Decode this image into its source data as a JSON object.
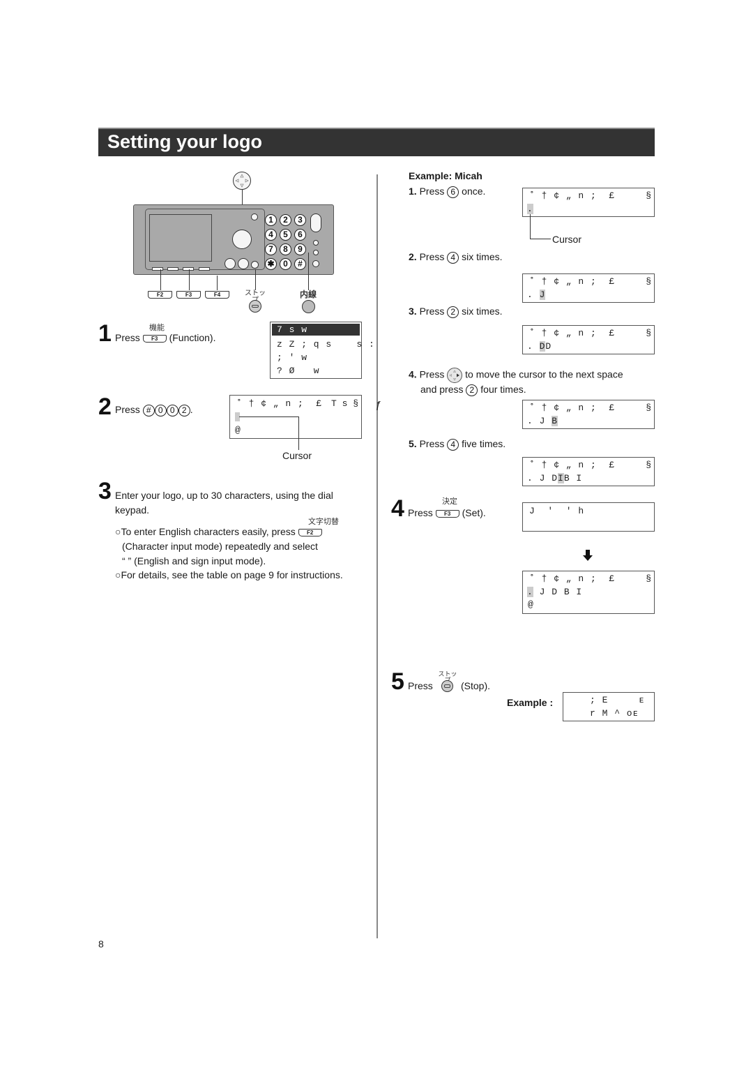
{
  "page": {
    "title": "Setting your logo",
    "page_number": "8"
  },
  "device": {
    "keypad": [
      "1",
      "2",
      "3",
      "4",
      "5",
      "6",
      "7",
      "8",
      "9",
      "✱",
      "0",
      "#"
    ],
    "fkeys": [
      "F2",
      "F3",
      "F4"
    ],
    "stop_label": "ストップ",
    "intercom_label": "内線"
  },
  "left": {
    "step1": {
      "num": "1",
      "press": "Press",
      "key_jp": "機能",
      "key": "F3",
      "suffix": "(Function).",
      "lcd": [
        "7 s w",
        "z Z ; q s    s :",
        "; ' w",
        "? Ø   w"
      ]
    },
    "step2": {
      "num": "2",
      "press": "Press",
      "keys": [
        "#",
        "0",
        "0",
        "2"
      ],
      "suffix": ".",
      "lcd_line1": "˚ † ¢ „ n ;  £",
      "lcd_line1_right": "T s §",
      "lcd_line3": "@",
      "cursor_label": "Cursor",
      "stray_glyph": "ƒ"
    },
    "step3": {
      "num": "3",
      "line1": "Enter your logo, up to 30 characters, using the dial",
      "line2": "keypad.",
      "bullet1_a": "○To enter English characters easily, press",
      "bullet1_key_jp": "文字切替",
      "bullet1_key": "F2",
      "bullet1_b": "(Character input mode) repeatedly and select",
      "bullet1_c": "“      ” (English and sign input mode).",
      "bullet2": "○For details, see the table on page 9 for instructions."
    }
  },
  "right": {
    "example_title": "Example: Micah",
    "lcd_header": "˚ † ¢ „ n ;  £",
    "lcd_header_right": "§",
    "sub1": {
      "num": "1.",
      "text_a": "Press",
      "key": "6",
      "text_b": "once.",
      "row2_cursor": ".",
      "row2_rest": "",
      "cursor_label": "Cursor"
    },
    "sub2": {
      "num": "2.",
      "text_a": "Press",
      "key": "4",
      "text_b": "six times.",
      "row2_pre": ". ",
      "row2_cursor": "J",
      "row2_rest": ""
    },
    "sub3": {
      "num": "3.",
      "text_a": "Press",
      "key": "2",
      "text_b": "six times.",
      "row2_pre": ". ",
      "row2_cursor": "D",
      "row2_rest": "D"
    },
    "sub4": {
      "num": "4.",
      "text_a": "Press",
      "text_b": "to move the cursor to the next space",
      "text_c": "and press",
      "key": "2",
      "text_d": "four times.",
      "row2_pre": ". J ",
      "row2_cursor": "B",
      "row2_rest": ""
    },
    "sub5": {
      "num": "5.",
      "text_a": "Press",
      "key": "4",
      "text_b": "five times.",
      "row2_pre": ". J D",
      "row2_cursor": "I",
      "row2_rest": "B I"
    },
    "step4": {
      "num": "4",
      "press": "Press",
      "key_jp": "決定",
      "key": "F3",
      "suffix": "(Set).",
      "lcd": "J  '  ' h"
    },
    "after": {
      "row2_cursor": ".",
      "row2_rest": " J D B I",
      "row3": "@"
    },
    "step5": {
      "num": "5",
      "press": "Press",
      "key_jp": "ストップ",
      "suffix": "(Stop).",
      "example_label": "Example :",
      "lcd_line1": "; E     ᴇ",
      "lcd_line2": "r M ^ ᴏᴇ"
    }
  }
}
